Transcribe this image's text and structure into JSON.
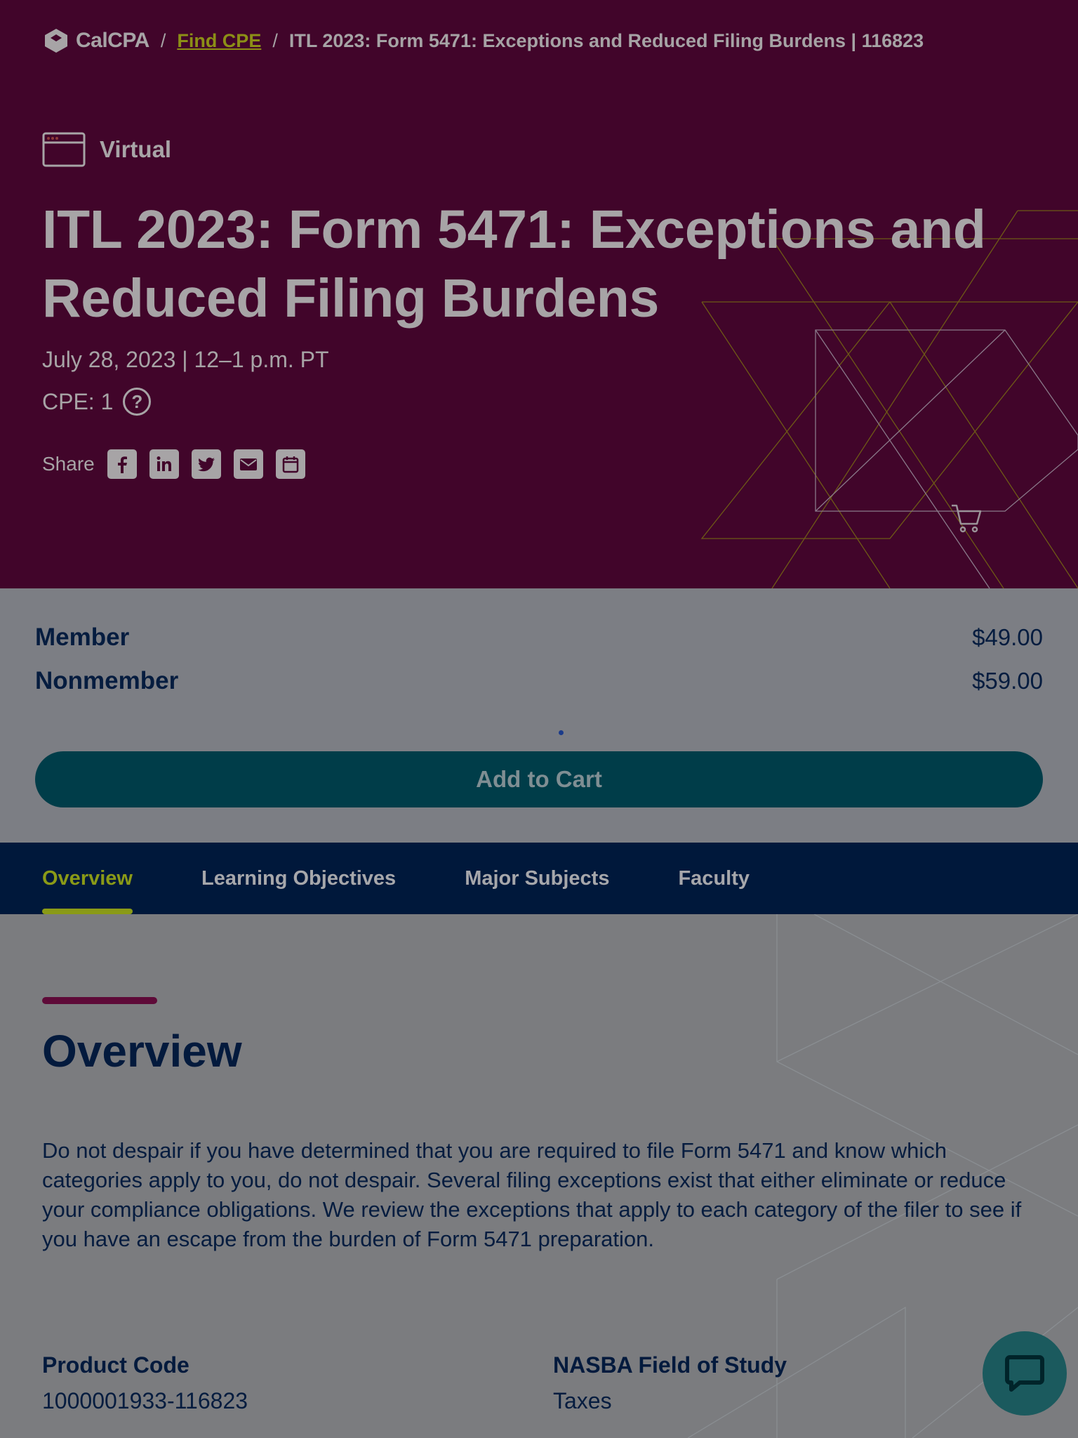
{
  "breadcrumb": {
    "logo_text": "CalCPA",
    "separator": "/",
    "link": "Find CPE",
    "current": "ITL 2023: Form 5471: Exceptions and Reduced Filing Burdens | 116823"
  },
  "event": {
    "format": "Virtual",
    "title": "ITL 2023: Form 5471: Exceptions and Reduced Filing Burdens",
    "date": "July 28, 2023 | 12–1 p.m. PT",
    "cpe": "CPE: 1",
    "cpe_help": "?"
  },
  "share": {
    "label": "Share",
    "icons": [
      "facebook-icon",
      "linkedin-icon",
      "twitter-icon",
      "email-icon",
      "calendar-icon"
    ]
  },
  "pricing": {
    "rows": [
      {
        "label": "Member",
        "price": "$49.00"
      },
      {
        "label": "Nonmember",
        "price": "$59.00"
      }
    ],
    "add_to_cart": "Add to Cart"
  },
  "tabs": [
    {
      "label": "Overview",
      "active": true
    },
    {
      "label": "Learning Objectives",
      "active": false
    },
    {
      "label": "Major Subjects",
      "active": false
    },
    {
      "label": "Faculty",
      "active": false
    }
  ],
  "overview": {
    "heading": "Overview",
    "body": "Do not despair if you have determined that you are required to file Form 5471 and know which categories apply to you, do not despair. Several filing exceptions exist that either eliminate or reduce your compliance obligations. We review the exceptions that apply to each category of the filer to see if you have an escape from the burden of Form 5471 preparation.",
    "product_code_label": "Product Code",
    "product_code": "1000001933-116823",
    "field_label": "NASBA Field of Study",
    "field_value": "Taxes"
  },
  "colors": {
    "hero_bg": "#41052a",
    "accent_lime": "#8a9a17",
    "navy": "#00183b",
    "teal": "#003d49"
  }
}
